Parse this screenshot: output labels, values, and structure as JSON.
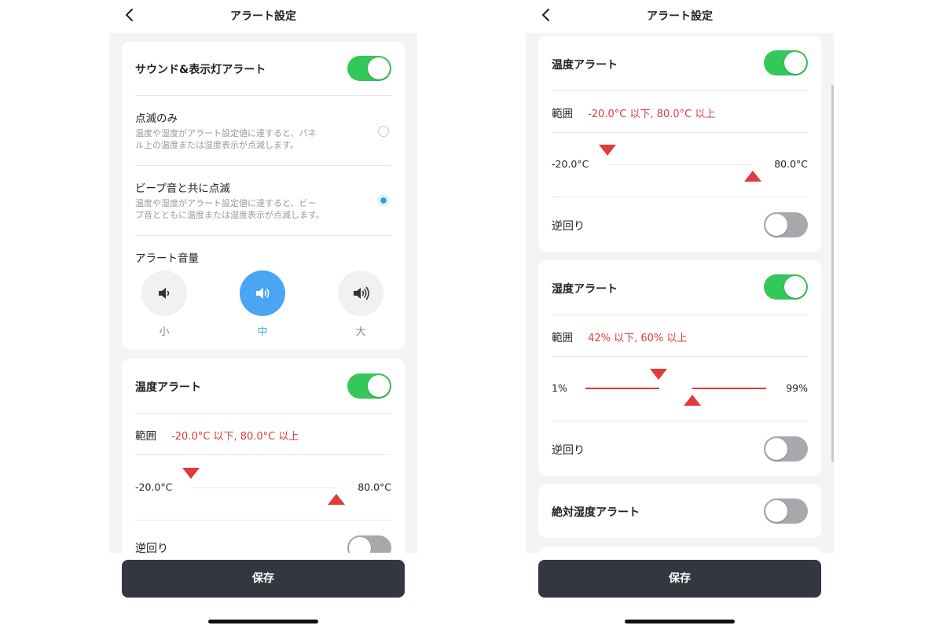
{
  "colors": {
    "accent_green": "#34c759",
    "accent_blue": "#4aa5f3",
    "alert_red": "#e03a3a",
    "save_bg": "#343740"
  },
  "left": {
    "nav": {
      "back_icon": "chevron-left-icon",
      "title": "アラート設定"
    },
    "sound_card": {
      "title": "サウンド&表示灯アラート",
      "toggle_on": true,
      "options": [
        {
          "title": "点滅のみ",
          "desc_line1": "温度や湿度がアラート設定値に達すると、パネ",
          "desc_line2": "ル上の温度または湿度表示が点滅します。",
          "selected": false
        },
        {
          "title": "ビープ音と共に点滅",
          "desc_line1": "温度や湿度がアラート設定値に達すると、ビー",
          "desc_line2": "プ音とともに温度または湿度表示が点滅します。",
          "selected": true
        }
      ],
      "volume_label": "アラート音量",
      "volume": {
        "options": [
          "小",
          "中",
          "大"
        ],
        "icons": [
          "speaker-low-icon",
          "speaker-medium-icon",
          "speaker-high-icon"
        ],
        "selected": "中"
      }
    },
    "temp_card": {
      "title": "温度アラート",
      "toggle_on": true,
      "range_label": "範囲",
      "range_value": "-20.0°C 以下, 80.0°C 以上",
      "min_label": "-20.0°C",
      "max_label": "80.0°C",
      "low_marker": -20.0,
      "high_marker": 80.0,
      "reverse_label": "逆回り",
      "reverse_on": false
    },
    "save_label": "保存"
  },
  "right": {
    "nav": {
      "back_icon": "chevron-left-icon",
      "title": "アラート設定"
    },
    "temp_card": {
      "title": "温度アラート",
      "toggle_on": true,
      "range_label": "範囲",
      "range_value": "-20.0°C 以下, 80.0°C 以上",
      "min_label": "-20.0°C",
      "max_label": "80.0°C",
      "low_marker": -20.0,
      "high_marker": 80.0,
      "reverse_label": "逆回り",
      "reverse_on": false
    },
    "humidity_card": {
      "title": "湿度アラート",
      "toggle_on": true,
      "range_label": "範囲",
      "range_value": "42% 以下, 60% 以上",
      "min_label": "1%",
      "max_label": "99%",
      "low_marker": 42,
      "high_marker": 60,
      "reverse_label": "逆回り",
      "reverse_on": false
    },
    "abs_humidity_card": {
      "title": "絶対湿度アラート",
      "toggle_on": false
    },
    "save_label": "保存"
  }
}
